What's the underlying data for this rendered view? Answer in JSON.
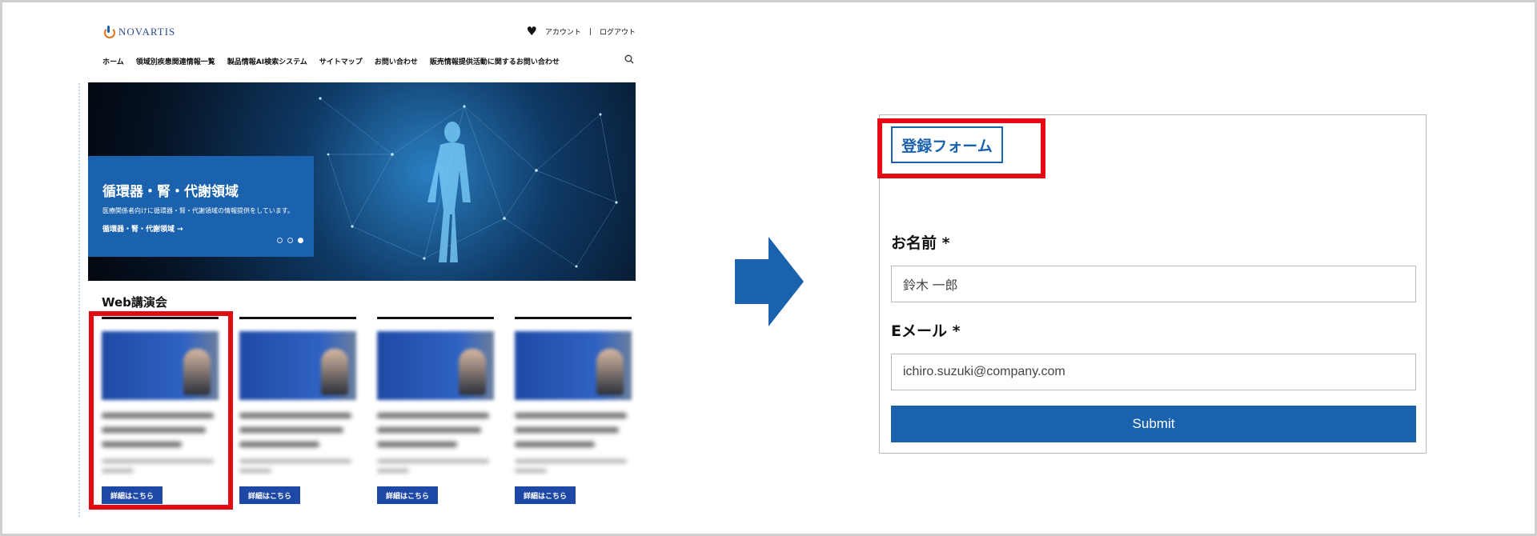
{
  "site": {
    "logo": "NOVARTIS",
    "account": {
      "link1": "アカウント",
      "separator": "|",
      "link2": "ログアウト"
    },
    "nav": [
      "ホーム",
      "領域別疾患関連情報一覧",
      "製品情報AI検索システム",
      "サイトマップ",
      "お問い合わせ",
      "販売情報提供活動に関するお問い合わせ"
    ],
    "hero": {
      "title": "循環器・腎・代謝領域",
      "description": "医療関係者向けに循環器・腎・代謝領域の情報提供をしています。",
      "link": "循環器・腎・代謝領域 →",
      "slide_count": 3,
      "active_slide": 3
    },
    "section_title": "Web講演会",
    "cards": [
      {
        "button": "詳細はこちら"
      },
      {
        "button": "詳細はこちら"
      },
      {
        "button": "詳細はこちら"
      },
      {
        "button": "詳細はこちら"
      }
    ]
  },
  "form": {
    "tag": "登録フォーム",
    "name_label": "お名前 *",
    "name_value": "鈴木 一郎",
    "email_label": "Eメール *",
    "email_value": "ichiro.suzuki@company.com",
    "submit": "Submit"
  },
  "colors": {
    "brand_blue": "#1b62ae",
    "highlight_red": "#e50914",
    "button_blue": "#1d48a6"
  }
}
